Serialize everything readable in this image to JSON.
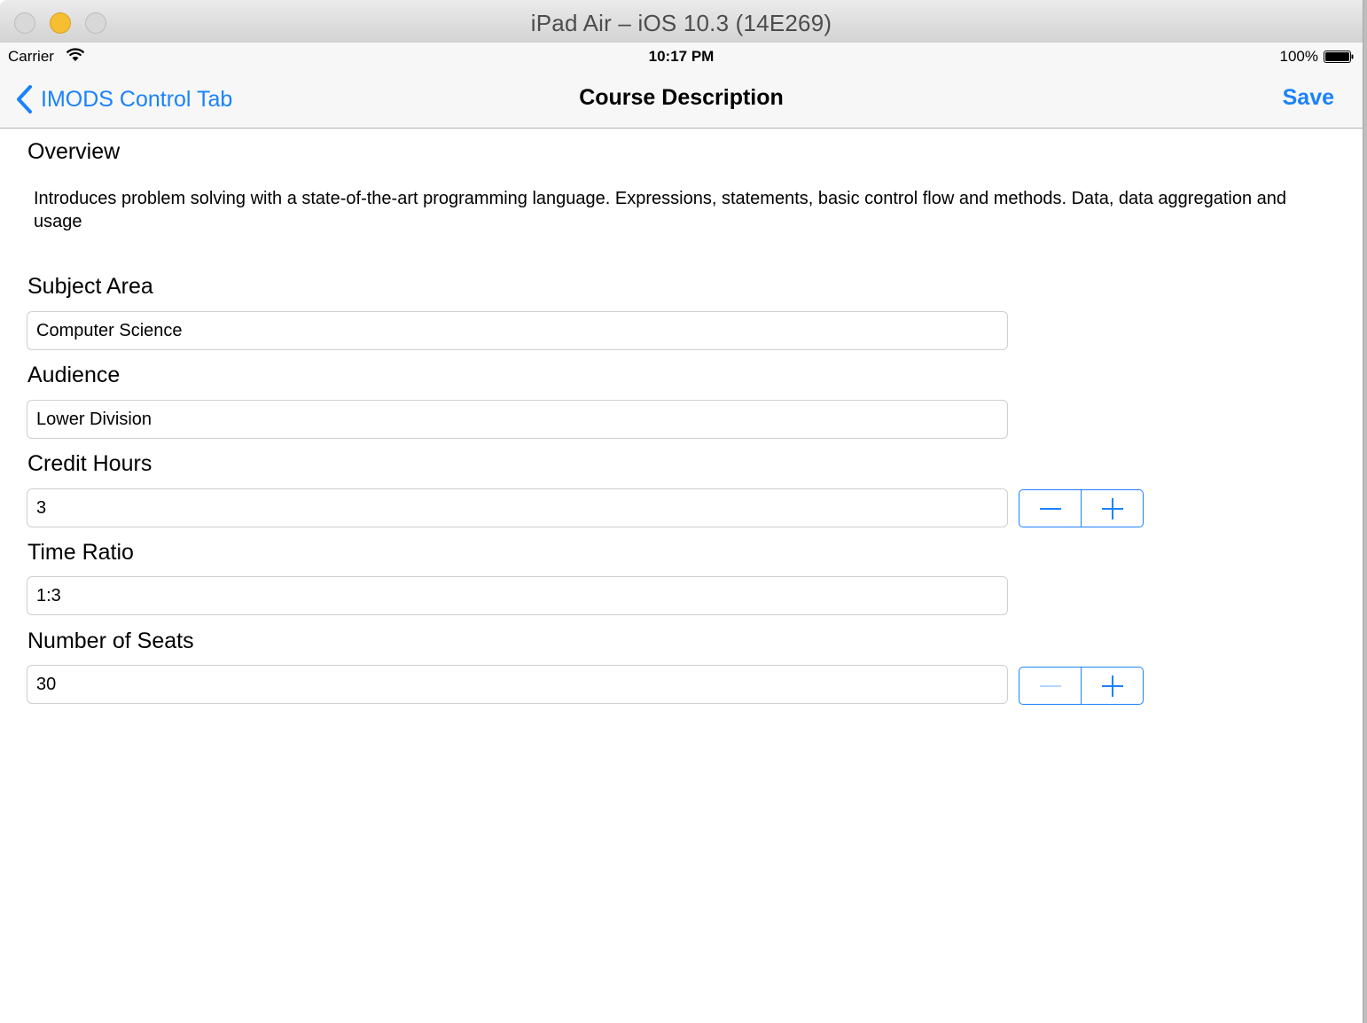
{
  "window": {
    "title": "iPad Air – iOS 10.3 (14E269)"
  },
  "status_bar": {
    "carrier": "Carrier",
    "time": "10:17 PM",
    "battery": "100%"
  },
  "nav": {
    "back_label": "IMODS Control Tab",
    "title": "Course Description",
    "save_label": "Save"
  },
  "overview": {
    "label": "Overview",
    "text": "Introduces problem solving with a state-of-the-art programming language. Expressions, statements, basic control flow and methods. Data, data aggregation and usage"
  },
  "fields": {
    "subject_area": {
      "label": "Subject Area",
      "value": "Computer Science"
    },
    "audience": {
      "label": "Audience",
      "value": "Lower Division"
    },
    "credit_hours": {
      "label": "Credit Hours",
      "value": "3"
    },
    "time_ratio": {
      "label": "Time Ratio",
      "value": "1:3"
    },
    "number_of_seats": {
      "label": "Number of Seats",
      "value": "30"
    }
  },
  "colors": {
    "accent": "#1a82fb",
    "stepper_disabled": "#b6d6fc"
  },
  "icons": [
    "back-chevron-icon",
    "wifi-icon",
    "battery-icon",
    "minus-icon",
    "plus-icon"
  ]
}
